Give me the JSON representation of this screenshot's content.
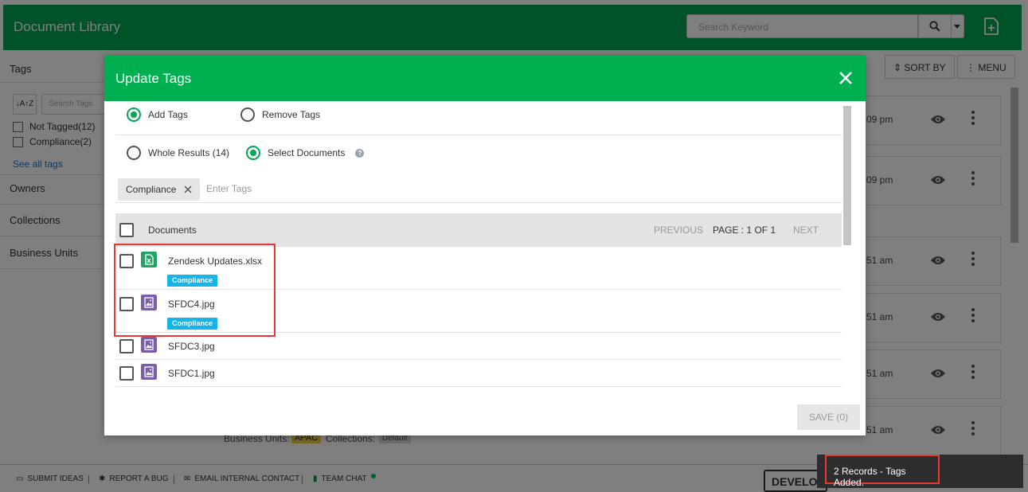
{
  "app": {
    "title": "Document Library",
    "search_placeholder": "Search Keyword"
  },
  "sidebar": {
    "tags_heading": "Tags",
    "sort_label": "↓A↑Z",
    "tag_search_placeholder": "Search Tags",
    "tags": [
      {
        "label": "Not Tagged(12)"
      },
      {
        "label": "Compliance(2)"
      }
    ],
    "see_all": "See all tags",
    "sections": [
      "Owners",
      "Collections",
      "Business Units"
    ]
  },
  "toolbar": {
    "sort_by": "SORT BY",
    "menu": "MENU"
  },
  "background_rows": [
    {
      "time": "09 pm"
    },
    {
      "time": "09 pm"
    },
    {
      "time": "51 am"
    },
    {
      "time": "51 am"
    },
    {
      "time": "51 am"
    },
    {
      "time": "51 am"
    },
    {
      "time": "51 am"
    }
  ],
  "background_bottom": {
    "business_units_label": "Business Units:",
    "business_unit": "APAC",
    "collections_label": "Collections:",
    "collection": "Default"
  },
  "footer": {
    "submit_ideas": "SUBMIT IDEAS",
    "report_bug": "REPORT A BUG",
    "email_contact": "EMAIL INTERNAL CONTACT",
    "team_chat": "TEAM CHAT",
    "separator": "|",
    "dev_button": "DEVELOP"
  },
  "modal": {
    "title": "Update Tags",
    "mode_options": [
      {
        "label": "Add Tags",
        "selected": true
      },
      {
        "label": "Remove Tags",
        "selected": false
      }
    ],
    "scope_options": [
      {
        "label": "Whole Results (14)",
        "selected": false
      },
      {
        "label": "Select Documents",
        "selected": true
      }
    ],
    "help_glyph": "?",
    "selected_tag": "Compliance",
    "tag_input_placeholder": "Enter Tags",
    "table": {
      "column_documents": "Documents",
      "previous": "PREVIOUS",
      "page_info": "PAGE : 1 OF 1",
      "next": "NEXT"
    },
    "documents": [
      {
        "name": "Zendesk Updates.xlsx",
        "icon": "excel-file-icon",
        "tag": "Compliance"
      },
      {
        "name": "SFDC4.jpg",
        "icon": "image-file-icon",
        "tag": "Compliance"
      },
      {
        "name": "SFDC3.jpg",
        "icon": "image-file-icon",
        "tag": ""
      },
      {
        "name": "SFDC1.jpg",
        "icon": "image-file-icon",
        "tag": ""
      }
    ],
    "save_label": "SAVE (0)"
  },
  "toast": {
    "message": "2 Records - Tags Added."
  },
  "colors": {
    "brand_green": "#00a651",
    "tag_blue": "#13b5ea",
    "excel_green": "#21a366",
    "image_purple": "#7b5ea7",
    "highlight_red": "#e53935"
  }
}
